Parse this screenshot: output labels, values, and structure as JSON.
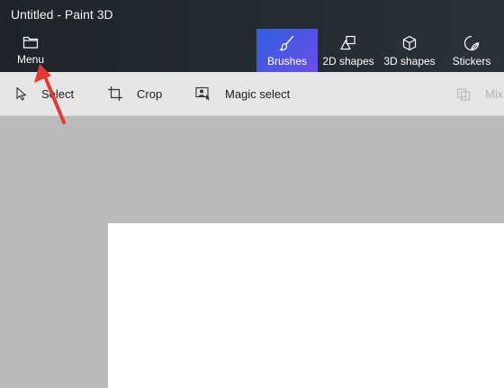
{
  "window": {
    "title": "Untitled - Paint 3D"
  },
  "menu": {
    "label": "Menu",
    "icon": "folder-icon"
  },
  "tabs": [
    {
      "label": "Brushes",
      "icon": "brush-icon",
      "active": true
    },
    {
      "label": "2D shapes",
      "icon": "2d-shapes-icon",
      "active": false
    },
    {
      "label": "3D shapes",
      "icon": "3d-cube-icon",
      "active": false
    },
    {
      "label": "Stickers",
      "icon": "sticker-icon",
      "active": false
    }
  ],
  "toolbar": {
    "select": "Select",
    "crop": "Crop",
    "magic_select": "Magic select",
    "mixed_reality": "Mix"
  },
  "colors": {
    "accent_start": "#2f5fe0",
    "accent_end": "#6a4ee8",
    "annotation_arrow": "#e53935",
    "titlebar": "#242b31",
    "toolbar": "#e6e6e6",
    "workspace": "#b9bab9",
    "canvas": "#ffffff"
  }
}
